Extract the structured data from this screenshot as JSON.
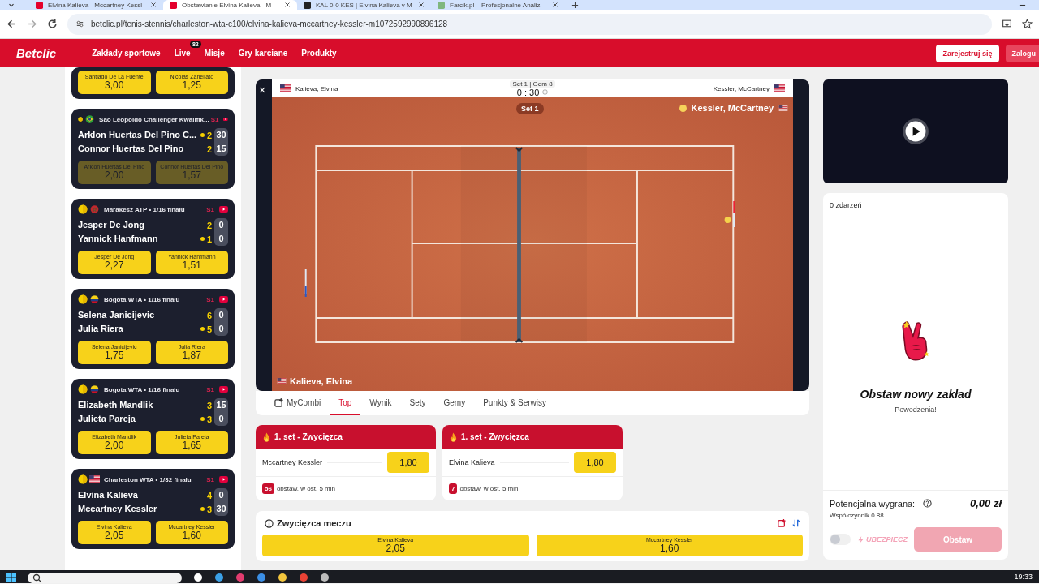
{
  "browser": {
    "tabs": [
      {
        "title": "Elvina Kalieva - Mccartney Kessl",
        "selected": false
      },
      {
        "title": "Obstawianie Elvina Kalieva - M",
        "selected": true
      },
      {
        "title": "KAL 0-0 KES | Elvina Kalieva v M",
        "selected": false
      },
      {
        "title": "Farcik.pl – Profesjonalne Analiz",
        "selected": false
      }
    ],
    "url": "betclic.pl/tenis-stennis/charleston-wta-c100/elvina-kalieva-mccartney-kessler-m1072592990896128"
  },
  "nav": {
    "logo": "Betclic",
    "items": [
      {
        "label": "Zakłady sportowe"
      },
      {
        "label": "Live",
        "badge": "82"
      },
      {
        "label": "Misje"
      },
      {
        "label": "Gry karciane"
      },
      {
        "label": "Produkty"
      }
    ],
    "register": "Zarejestruj się",
    "login": "Zalogu"
  },
  "matches": [
    {
      "suspended": false,
      "odds": [
        {
          "label": "Santiago De La Fuente",
          "value": "3,00"
        },
        {
          "label": "Nicolas Zanellato",
          "value": "1,25"
        }
      ]
    },
    {
      "tournament": "Sao Leopoldo Challenger Kwalifik...",
      "flag": {
        "kind": "br"
      },
      "set": "S1",
      "suspended": true,
      "players": [
        {
          "name": "Arklon Huertas Del Pino C...",
          "serving": true,
          "games": "2",
          "points": "30"
        },
        {
          "name": "Connor Huertas Del Pino",
          "serving": false,
          "games": "2",
          "points": "15"
        }
      ],
      "odds": [
        {
          "label": "Arklon Huertas Del Pino",
          "value": "2,00"
        },
        {
          "label": "Connor Huertas Del Pino",
          "value": "1,57"
        }
      ]
    },
    {
      "tournament": "Marakesz ATP • 1/16 finału",
      "flag": {
        "kind": "ma"
      },
      "set": "S1",
      "suspended": false,
      "players": [
        {
          "name": "Jesper De Jong",
          "serving": false,
          "games": "2",
          "points": "0"
        },
        {
          "name": "Yannick Hanfmann",
          "serving": true,
          "games": "1",
          "points": "0"
        }
      ],
      "odds": [
        {
          "label": "Jesper De Jong",
          "value": "2,27"
        },
        {
          "label": "Yannick Hanfmann",
          "value": "1,51"
        }
      ]
    },
    {
      "tournament": "Bogota WTA • 1/16 finału",
      "flag": {
        "kind": "co"
      },
      "set": "S1",
      "suspended": false,
      "players": [
        {
          "name": "Selena Janicijevic",
          "serving": false,
          "games": "6",
          "points": "0"
        },
        {
          "name": "Julia Riera",
          "serving": true,
          "games": "5",
          "points": "0"
        }
      ],
      "odds": [
        {
          "label": "Selena Janicijevic",
          "value": "1,75"
        },
        {
          "label": "Julia Riera",
          "value": "1,87"
        }
      ]
    },
    {
      "tournament": "Bogota WTA • 1/16 finału",
      "flag": {
        "kind": "co"
      },
      "set": "S1",
      "suspended": false,
      "players": [
        {
          "name": "Elizabeth Mandlik",
          "serving": false,
          "games": "3",
          "points": "15"
        },
        {
          "name": "Julieta Pareja",
          "serving": true,
          "games": "3",
          "points": "0"
        }
      ],
      "odds": [
        {
          "label": "Elizabeth Mandlik",
          "value": "2,00"
        },
        {
          "label": "Julieta Pareja",
          "value": "1,65"
        }
      ]
    },
    {
      "tournament": "Charleston WTA • 1/32 finału",
      "flag": {
        "kind": "us"
      },
      "set": "S1",
      "suspended": false,
      "players": [
        {
          "name": "Elvina Kalieva",
          "serving": false,
          "games": "4",
          "points": "0"
        },
        {
          "name": "Mccartney Kessler",
          "serving": true,
          "games": "3",
          "points": "30"
        }
      ],
      "odds": [
        {
          "label": "Elvina Kalieva",
          "value": "2,05"
        },
        {
          "label": "Mccartney Kessler",
          "value": "1,60"
        }
      ]
    }
  ],
  "scoreboard": {
    "close": "×",
    "home": "Kalieva, Elvina",
    "away": "Kessler, McCartney",
    "period": "Set 1 | Gem 8",
    "score": "0 : 30"
  },
  "court": {
    "set_label": "Set 1",
    "top_player": "Kessler, McCartney",
    "top_serving": true,
    "bottom_player": "Kalieva, Elvina"
  },
  "market_tabs": [
    {
      "label": "MyCombi",
      "selected": false
    },
    {
      "label": "Top",
      "selected": true
    },
    {
      "label": "Wynik",
      "selected": false
    },
    {
      "label": "Sety",
      "selected": false
    },
    {
      "label": "Gemy",
      "selected": false
    },
    {
      "label": "Punkty & Serwisy",
      "selected": false
    }
  ],
  "featured": [
    {
      "title": "1. set - Zwycięzca",
      "selection": "Mccartney Kessler",
      "odd": "1,80",
      "count": "56",
      "note": "obstaw. w ost. 5 min"
    },
    {
      "title": "1. set - Zwycięzca",
      "selection": "Elvina Kalieva",
      "odd": "1,80",
      "count": "7",
      "note": "obstaw. w ost. 5 min"
    }
  ],
  "match_winner": {
    "title": "Zwycięzca meczu",
    "odds": [
      {
        "label": "Elvina Kalieva",
        "value": "2,05"
      },
      {
        "label": "Mccartney Kessler",
        "value": "1,60"
      }
    ]
  },
  "betslip": {
    "count": "0 zdarzeń",
    "heading": "Obstaw nowy zakład",
    "sub": "Powodzenia!",
    "potential_label": "Potencjalna wygrana:",
    "potential_value": "0,00 zł",
    "coefficient": "Współczynnik 0.88",
    "insure_on": false,
    "insure_label": "UBEZPIECZ",
    "submit": "Obstaw",
    "submit_disabled": true
  },
  "taskbar": {
    "time": "19:33"
  }
}
